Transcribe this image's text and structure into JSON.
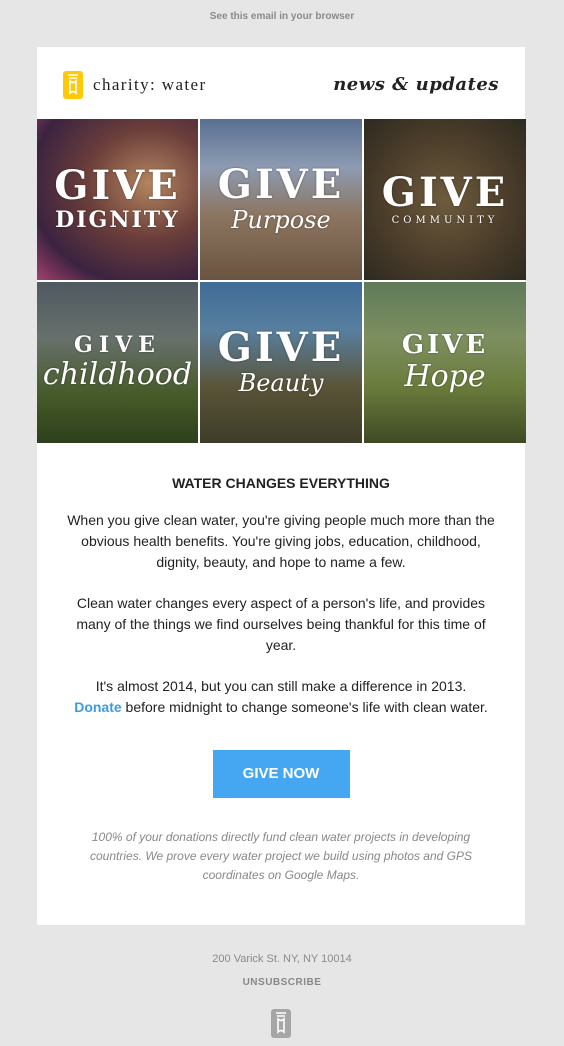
{
  "top_link": "See this email in your browser",
  "header": {
    "logo_text": "charity: water",
    "logo_icon": "jerrycan-icon",
    "tagline": "news & updates"
  },
  "tiles": [
    {
      "w1": "GIVE",
      "w2": "DIGNITY"
    },
    {
      "w1": "GIVE",
      "w2": "Purpose"
    },
    {
      "w1": "GIVE",
      "w2": "COMMUNITY"
    },
    {
      "w1": "GIVE",
      "w2": "childhood"
    },
    {
      "w1": "GIVE",
      "w2": "Beauty"
    },
    {
      "w1": "GIVE",
      "w2": "Hope"
    }
  ],
  "content": {
    "headline": "WATER CHANGES EVERYTHING",
    "p1": "When you give clean water, you're giving people much more than the obvious health benefits. You're giving jobs, education, childhood, dignity, beauty, and hope to name a few.",
    "p2": "Clean water changes every aspect of a person's life, and provides many of the things we find ourselves being thankful for this time of year.",
    "p3_line1": "It's almost 2014, but you can still make a difference in 2013.",
    "p3_donate": "Donate",
    "p3_rest": " before midnight to change someone's life with clean water.",
    "button": "GIVE NOW",
    "fine_print": "100% of your donations directly fund clean water projects in developing countries. We prove every water project we build using photos and GPS coordinates on Google Maps."
  },
  "footer": {
    "address": "200 Varick St. NY, NY 10014",
    "unsubscribe": "UNSUBSCRIBE",
    "icon": "jerrycan-icon"
  },
  "colors": {
    "accent": "#45a7f2",
    "logo_yellow": "#ffc907",
    "background": "#e6e6e6"
  }
}
